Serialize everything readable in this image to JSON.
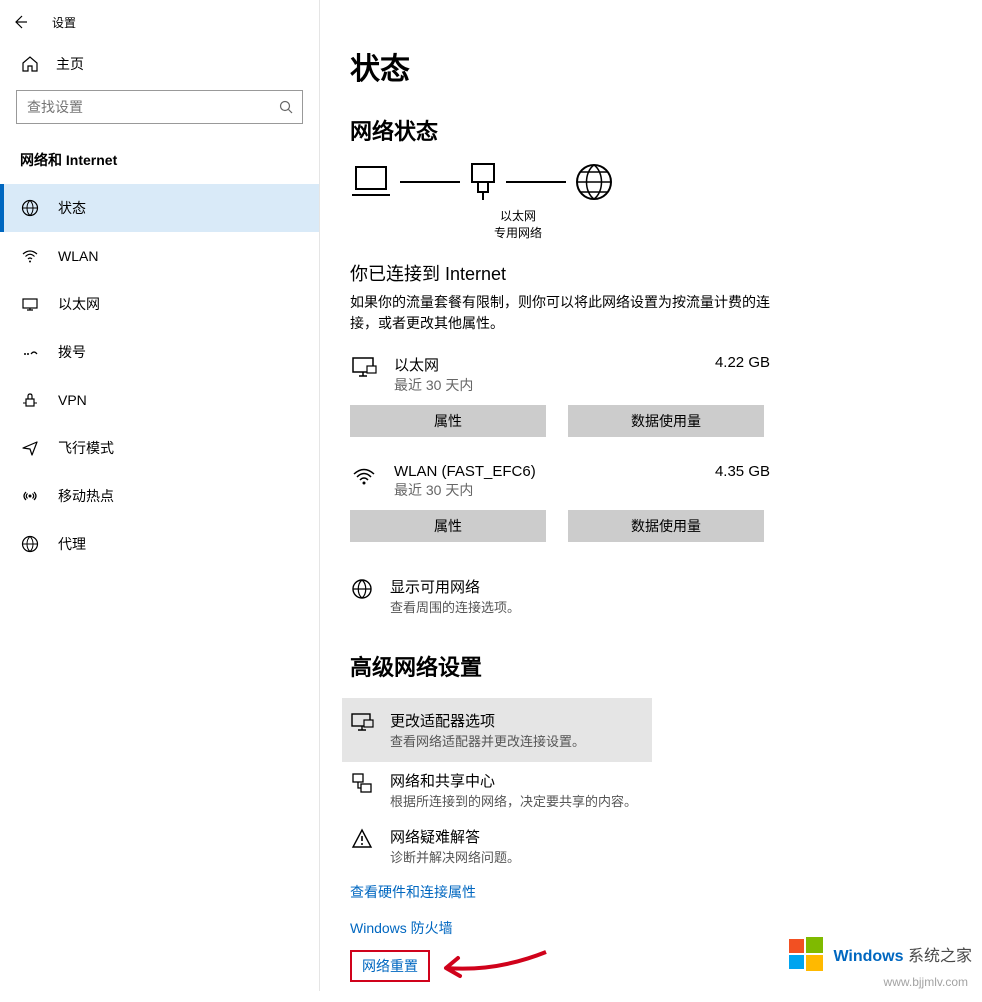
{
  "window": {
    "title": "设置"
  },
  "sidebar": {
    "home_label": "主页",
    "search_placeholder": "查找设置",
    "section_label": "网络和 Internet",
    "items": [
      {
        "icon": "status-icon",
        "label": "状态",
        "active": true
      },
      {
        "icon": "wifi-icon",
        "label": "WLAN"
      },
      {
        "icon": "ethernet-icon",
        "label": "以太网"
      },
      {
        "icon": "dialup-icon",
        "label": "拨号"
      },
      {
        "icon": "vpn-icon",
        "label": "VPN"
      },
      {
        "icon": "airplane-icon",
        "label": "飞行模式"
      },
      {
        "icon": "hotspot-icon",
        "label": "移动热点"
      },
      {
        "icon": "proxy-icon",
        "label": "代理"
      }
    ]
  },
  "main": {
    "page_title": "状态",
    "network_status_heading": "网络状态",
    "diagram": {
      "adapter": "以太网",
      "profile": "专用网络"
    },
    "connected_heading": "你已连接到 Internet",
    "connected_desc": "如果你的流量套餐有限制，则你可以将此网络设置为按流量计费的连接，或者更改其他属性。",
    "connections": [
      {
        "icon": "ethernet-icon",
        "name": "以太网",
        "sub": "最近 30 天内",
        "usage": "4.22 GB"
      },
      {
        "icon": "wifi-icon",
        "name": "WLAN (FAST_EFC6)",
        "sub": "最近 30 天内",
        "usage": "4.35 GB"
      }
    ],
    "btn_properties": "属性",
    "btn_data_usage": "数据使用量",
    "show_networks": {
      "title": "显示可用网络",
      "sub": "查看周围的连接选项。"
    },
    "advanced_heading": "高级网络设置",
    "advanced_items": [
      {
        "icon": "adapter-icon",
        "title": "更改适配器选项",
        "sub": "查看网络适配器并更改连接设置。",
        "hover": true
      },
      {
        "icon": "share-icon",
        "title": "网络和共享中心",
        "sub": "根据所连接到的网络，决定要共享的内容。"
      },
      {
        "icon": "troubleshoot-icon",
        "title": "网络疑难解答",
        "sub": "诊断并解决网络问题。"
      }
    ],
    "links": [
      "查看硬件和连接属性",
      "Windows 防火墙",
      "网络重置"
    ]
  },
  "watermark": {
    "brand": "Windows",
    "brand_suffix": "系统之家",
    "url": "www.bjjmlv.com"
  }
}
